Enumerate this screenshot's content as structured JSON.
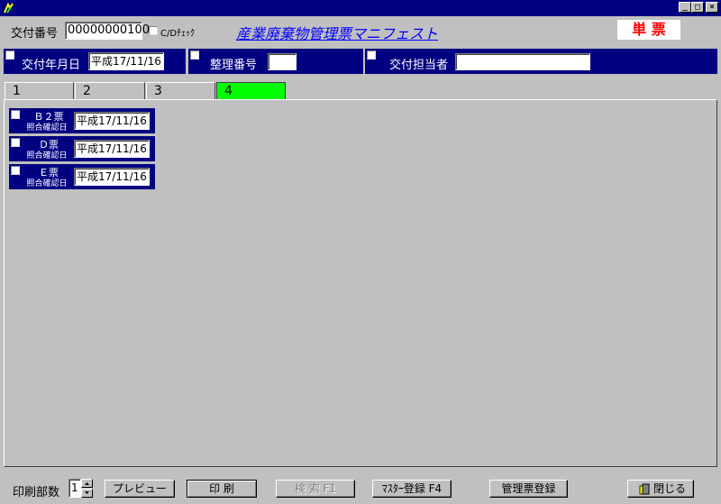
{
  "window": {
    "minimize_glyph": "_",
    "maximize_glyph": "□",
    "close_glyph": "×"
  },
  "header": {
    "slip_no_label": "交付番号",
    "slip_no_value": "00000000100",
    "cd_check_label": "C/Dﾁｪｯｸ",
    "title": "産業廃棄物管理票マニフェスト",
    "single_slip_label": "単 票",
    "title_color": "#0000ff",
    "single_slip_color": "#ff0000"
  },
  "filters": {
    "issue_date_label": "交付年月日",
    "issue_date_value": "平成17/11/16",
    "ref_no_label": "整理番号",
    "ref_no_value": "",
    "person_label": "交付担当者",
    "person_value": ""
  },
  "tabs": [
    {
      "label": "1"
    },
    {
      "label": "2"
    },
    {
      "label": "3"
    },
    {
      "label": "4"
    }
  ],
  "slips": [
    {
      "name": "Ｂ２票",
      "sub": "照合確認日",
      "date": "平成17/11/16"
    },
    {
      "name": "Ｄ票",
      "sub": "照合確認日",
      "date": "平成17/11/16"
    },
    {
      "name": "Ｅ票",
      "sub": "照合確認日",
      "date": "平成17/11/16"
    }
  ],
  "footer": {
    "copies_label": "印刷部数",
    "copies_value": "1",
    "preview_button": "プレビュー",
    "print_button": "印 刷",
    "search_button": "検 索 F1",
    "master_button": "ﾏｽﾀｰ登録 F4",
    "register_button": "管理票登録",
    "close_button": "閉じる"
  },
  "colors": {
    "navy": "#000080",
    "active_tab": "#00ff00"
  }
}
